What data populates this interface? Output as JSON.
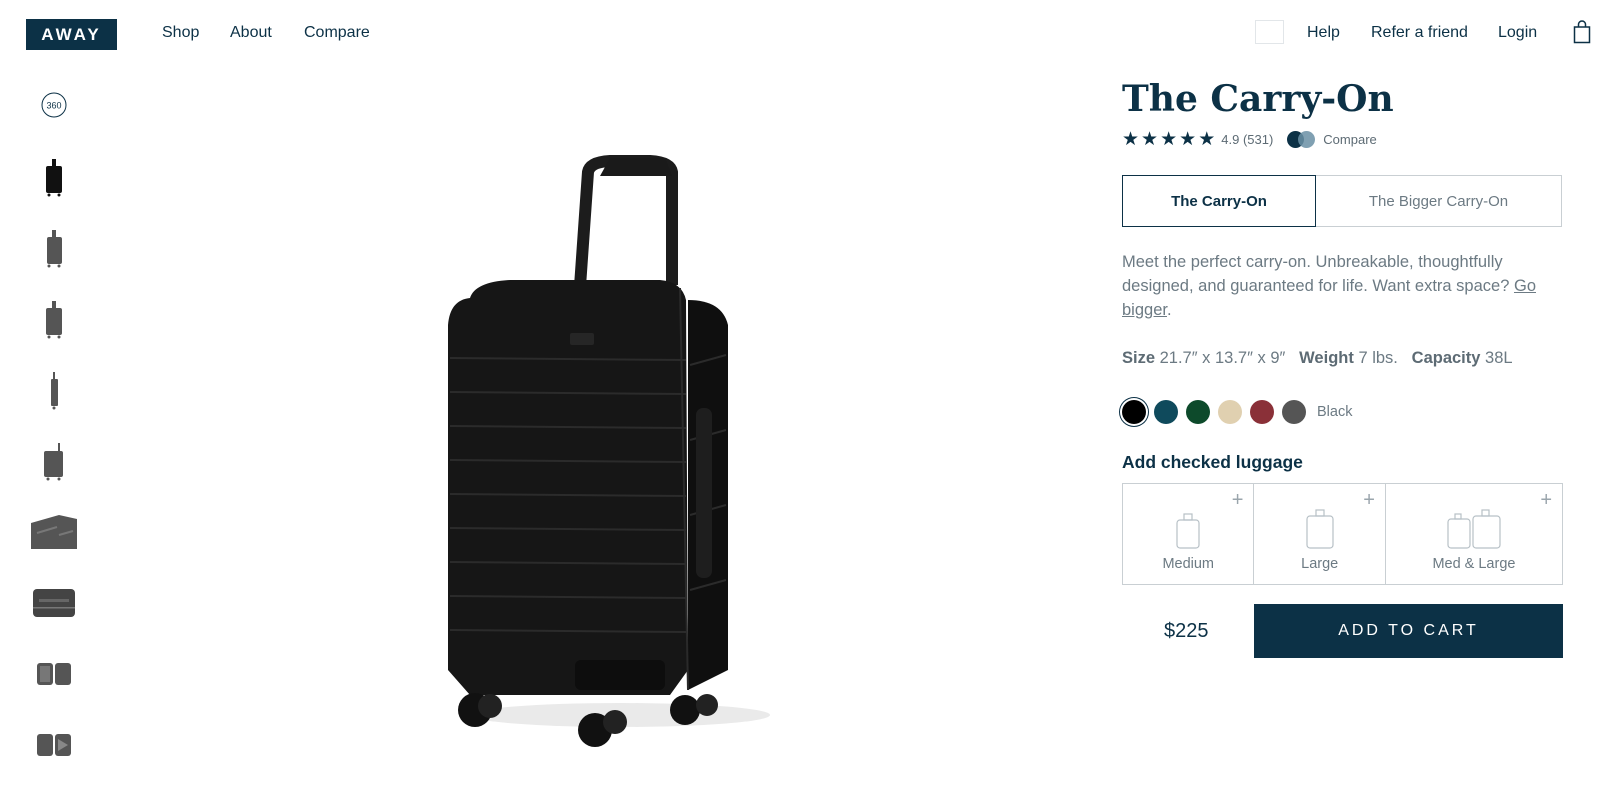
{
  "header": {
    "logo": "AWAY",
    "nav": [
      "Shop",
      "About",
      "Compare"
    ],
    "help": "Help",
    "refer": "Refer a friend",
    "login": "Login"
  },
  "thumbnails": [
    "360-view-icon",
    "carry-on-front",
    "carry-on-angle",
    "carry-on-side-angle",
    "carry-on-side",
    "carry-on-back",
    "carry-on-interior",
    "carry-on-top",
    "carry-on-open",
    "carry-on-open-packed"
  ],
  "thumbnail_360_label": "360",
  "product": {
    "title": "The Carry-On",
    "rating": "4.9",
    "reviews": "(531)",
    "compare": "Compare",
    "tabs": [
      "The Carry-On",
      "The Bigger Carry-On"
    ],
    "description": "Meet the perfect carry-on. Unbreakable, thoughtfully designed, and guaranteed for life. Want extra space?",
    "description_link": "Go bigger",
    "description_end": ".",
    "specs": {
      "size_label": "Size",
      "size": "21.7″ x 13.7″ x 9″",
      "weight_label": "Weight",
      "weight": "7 lbs.",
      "capacity_label": "Capacity",
      "capacity": "38L"
    },
    "colors": [
      "#000000",
      "#0f4a5c",
      "#0d4a2b",
      "#e0d0b0",
      "#8a3038",
      "#555555"
    ],
    "selected_color": "Black",
    "add_checked_label": "Add checked luggage",
    "checked_options": [
      "Medium",
      "Large",
      "Med & Large"
    ],
    "price": "$225",
    "add_to_cart": "ADD TO CART"
  }
}
